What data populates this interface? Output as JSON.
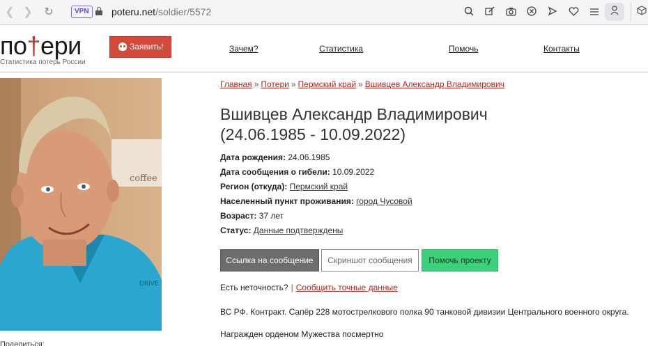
{
  "browser": {
    "vpn_label": "VPN",
    "url_host": "poteru.net",
    "url_path": "/soldier/5572"
  },
  "site": {
    "logo_part1": "по",
    "logo_cross": "†",
    "logo_part2": "ери",
    "logo_subtitle": "Статистика потерь России",
    "report_button": "Заявить!",
    "nav": [
      "Зачем?",
      "Статистика",
      "Помочь",
      "Контакты"
    ]
  },
  "breadcrumb": [
    "Главная",
    "Потери",
    "Пермский край",
    "Вшивцев Александр Владимирович"
  ],
  "breadcrumb_separator": "»",
  "person": {
    "name": "Вшивцев Александр Владимирович",
    "dates": "(24.06.1985 - 10.09.2022)"
  },
  "fields": {
    "birth_label": "Дата рождения:",
    "birth_value": "24.06.1985",
    "death_label": "Дата сообщения о гибели:",
    "death_value": "10.09.2022",
    "region_label": "Регион (откуда):",
    "region_value": "Пермский край",
    "city_label": "Населенный пункт проживания:",
    "city_value": "город Чусовой",
    "age_label": "Возраст:",
    "age_value": "37 лет",
    "status_label": "Статус:",
    "status_value": "Данные подтверждены"
  },
  "buttons": {
    "link": "Ссылка на сообщение",
    "screenshot": "Скриншот сообщения",
    "help": "Помочь проекту"
  },
  "inaccuracy": {
    "question": "Есть неточность?",
    "separator": "|",
    "link": "Сообщить точные данные"
  },
  "bio": "ВС РФ. Контракт. Сапёр 228 мотострелкового полка 90 танковой дивизии Центрального военного округа.",
  "award": "Награжден орденом Мужества посмертно",
  "share_label": "Поделиться:",
  "colors": {
    "accent_red": "#d34a3a",
    "link_red": "#b3261e",
    "help_green": "#3dd07a"
  }
}
